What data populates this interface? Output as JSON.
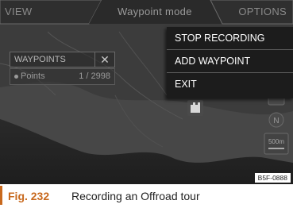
{
  "topbar": {
    "view_label": "VIEW",
    "title": "Waypoint mode",
    "options_label": "OPTIONS"
  },
  "menu": {
    "items": [
      {
        "label": "STOP RECORDING"
      },
      {
        "label": "ADD WAYPOINT"
      },
      {
        "label": "EXIT"
      }
    ]
  },
  "waypoints_panel": {
    "title": "WAYPOINTS",
    "row_label": "Points",
    "row_value": "1 / 2998"
  },
  "map_controls": {
    "scale_label": "500m",
    "compass_letter": "N"
  },
  "image_code": "B5F-0888",
  "caption": {
    "figure": "Fig. 232",
    "text": "Recording an Offroad tour"
  },
  "colors": {
    "accent": "#c8691e",
    "menu_bg": "#1c1c1c",
    "screen_bg": "#3a3a3a"
  }
}
